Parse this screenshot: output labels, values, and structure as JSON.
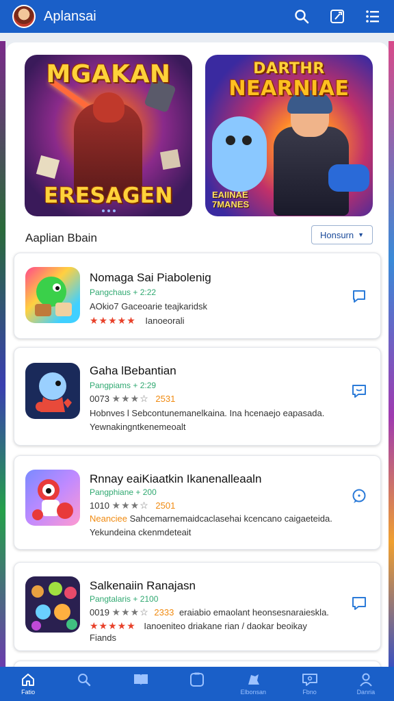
{
  "app": {
    "title": "Aplansai"
  },
  "banners": [
    {
      "title_top": "MGAKAN",
      "title_bottom": "ERESAGEN"
    },
    {
      "title_top": "DARTHR",
      "title_top2": "NEARNIAE",
      "subtitle_line1": "EAIINAE",
      "subtitle_line2": "7MANES"
    }
  ],
  "section": {
    "title": "Aaplian Bbain",
    "sort_label": "Honsurn"
  },
  "items": [
    {
      "name": "Nomaga Sai Piabolenig",
      "meta": "Pangchaus + 2:22",
      "line1": "AOkio7 Gaceoarie teajkaridsk",
      "stars": "★★★★★",
      "line2_text": "Ianoeorali"
    },
    {
      "name": "Gaha lBebantian",
      "meta": "Pangpiams + 2:29",
      "rating_num": "0073",
      "stars_gray": "★★★",
      "count": "2531",
      "line2": "Hobnves l Sebcontunemanelkaina. Ina hcenaejo eapasada.",
      "line3": "Yewnakingntkenemeoalt"
    },
    {
      "name": "Rnnay eaiKiaatkin Ikanenalleaaln",
      "meta": "Pangphiane + 200",
      "rating_num": "1010",
      "stars_gray": "★★★",
      "count": "2501",
      "prefix": "Neanciee",
      "line2": "Sahcemarnemaidcaclasehai kcencano caigaeteida.",
      "line3": "Yekundeina ckenmdeteait"
    },
    {
      "name": "Salkenaiin Ranajasn",
      "meta": "Pangtalaris + 2100",
      "rating_num": "0019",
      "stars_gray": "★★★",
      "count": "2333",
      "line2": "eraiabio emaolant heonsesnaraieskla.",
      "stars": "★★★★★",
      "line3": "Ianoeniteo driakane rian / daokar beoikay",
      "line4": "Fiands"
    }
  ],
  "bottom_nav": [
    {
      "icon": "home-icon",
      "label": "Fatio"
    },
    {
      "icon": "search-icon",
      "label": ""
    },
    {
      "icon": "book-icon",
      "label": ""
    },
    {
      "icon": "square-icon",
      "label": ""
    },
    {
      "icon": "gamepad-icon",
      "label": "Elbonsan"
    },
    {
      "icon": "chat-icon",
      "label": "Fbno"
    },
    {
      "icon": "profile-icon",
      "label": "Danria"
    }
  ],
  "colors": {
    "primary": "#1a5fc8",
    "star": "#e8412a",
    "meta_green": "#2fa870",
    "accent_orange": "#f08a10"
  }
}
